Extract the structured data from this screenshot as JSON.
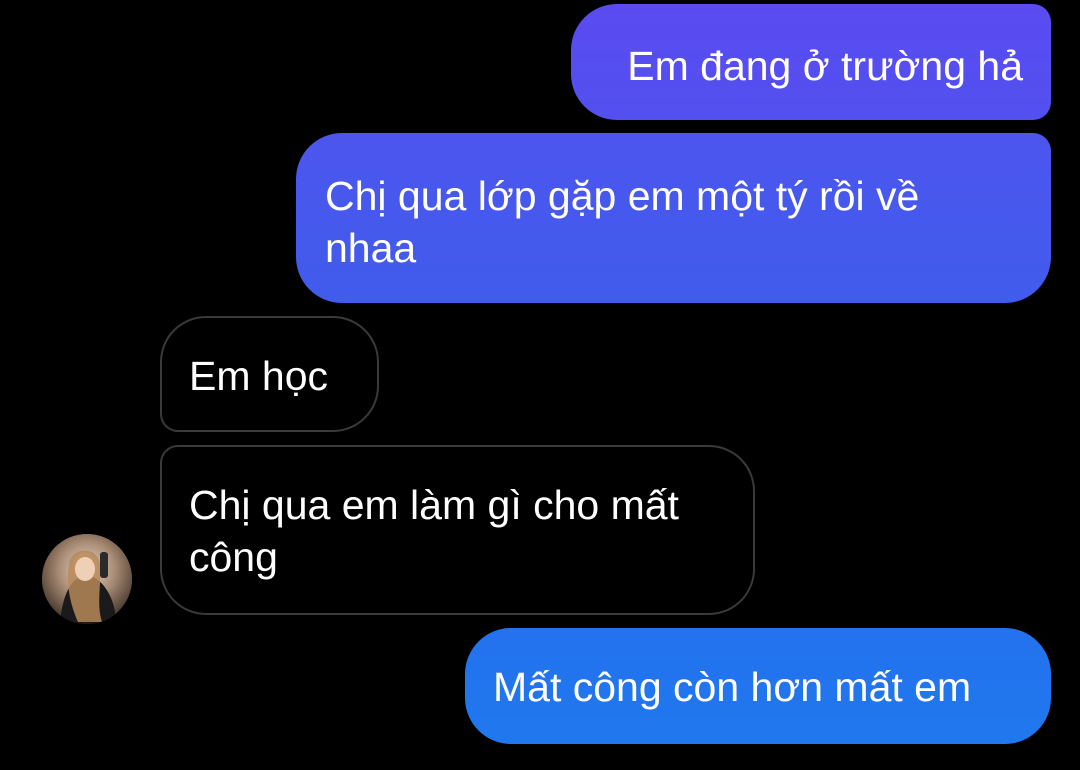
{
  "conversation": {
    "colors": {
      "sent_top": "#5a4ff0",
      "sent_mid": "#4558ec",
      "sent_bottom": "#2174ee",
      "received_border": "#3a3a3a",
      "background": "#000000"
    },
    "messages": [
      {
        "id": "m1",
        "sender": "me",
        "text": "Em đang ở trường hả"
      },
      {
        "id": "m2",
        "sender": "me",
        "text": "Chị qua lớp gặp em một tý rồi về nhaa"
      },
      {
        "id": "m3",
        "sender": "other",
        "text": "Em học"
      },
      {
        "id": "m4",
        "sender": "other",
        "text": "Chị qua em làm gì cho mất công"
      },
      {
        "id": "m5",
        "sender": "me",
        "text": "Mất công còn hơn mất em"
      }
    ],
    "avatar_icon": "contact-avatar-photo"
  }
}
